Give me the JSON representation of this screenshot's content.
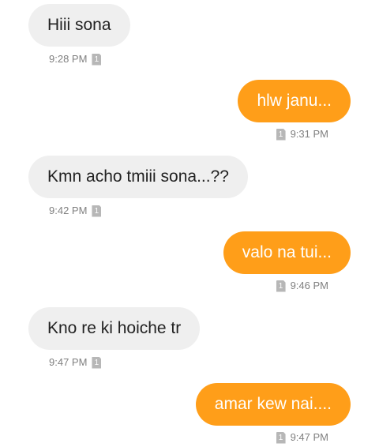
{
  "accent_color": "#ff9e19",
  "incoming_color": "#efefef",
  "icons": {
    "sim": "sim-card-icon"
  },
  "messages": [
    {
      "direction": "incoming",
      "text": "Hiii sona",
      "time": "9:28 PM",
      "sim": "1"
    },
    {
      "direction": "outgoing",
      "text": "hlw janu...",
      "time": "9:31 PM",
      "sim": "1"
    },
    {
      "direction": "incoming",
      "text": "Kmn acho tmiii sona...??",
      "time": "9:42 PM",
      "sim": "1"
    },
    {
      "direction": "outgoing",
      "text": "valo na tui...",
      "time": "9:46 PM",
      "sim": "1"
    },
    {
      "direction": "incoming",
      "text": "Kno re ki hoiche tr",
      "time": "9:47 PM",
      "sim": "1"
    },
    {
      "direction": "outgoing",
      "text": "amar kew nai....",
      "time": "9:47 PM",
      "sim": "1"
    }
  ]
}
